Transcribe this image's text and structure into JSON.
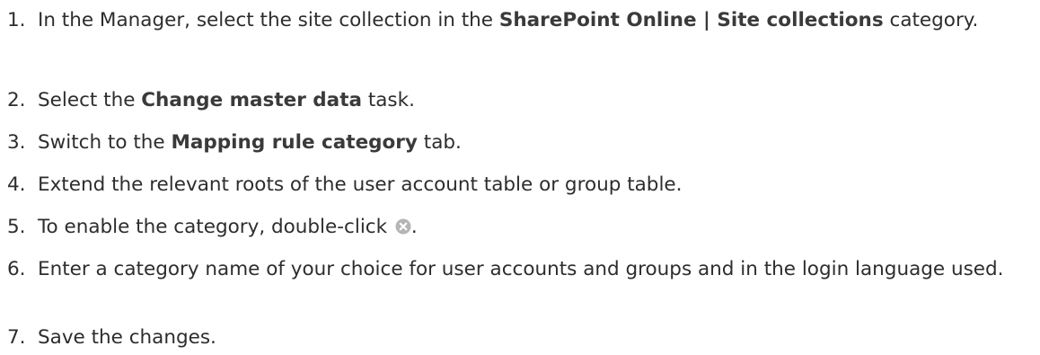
{
  "steps": [
    {
      "number": "1.",
      "pre": "In the Manager, select the site collection in the ",
      "bold": "SharePoint Online | Site collections",
      "post": " category."
    },
    {
      "number": "2.",
      "pre": "Select the ",
      "bold": "Change master data",
      "post": " task."
    },
    {
      "number": "3.",
      "pre": "Switch to the ",
      "bold": "Mapping rule category",
      "post": " tab."
    },
    {
      "number": "4.",
      "text": "Extend the relevant roots of the user account table or group table."
    },
    {
      "number": "5.",
      "pre": "To enable the category, double-click ",
      "icon": "disabled-x-icon",
      "post": "."
    },
    {
      "number": "6.",
      "text": "Enter a category name of your choice for user accounts and groups and in the login language used."
    },
    {
      "number": "7.",
      "text": "Save the changes."
    }
  ],
  "colors": {
    "text": "#2d2d2d",
    "icon": "#b5b5b5"
  }
}
